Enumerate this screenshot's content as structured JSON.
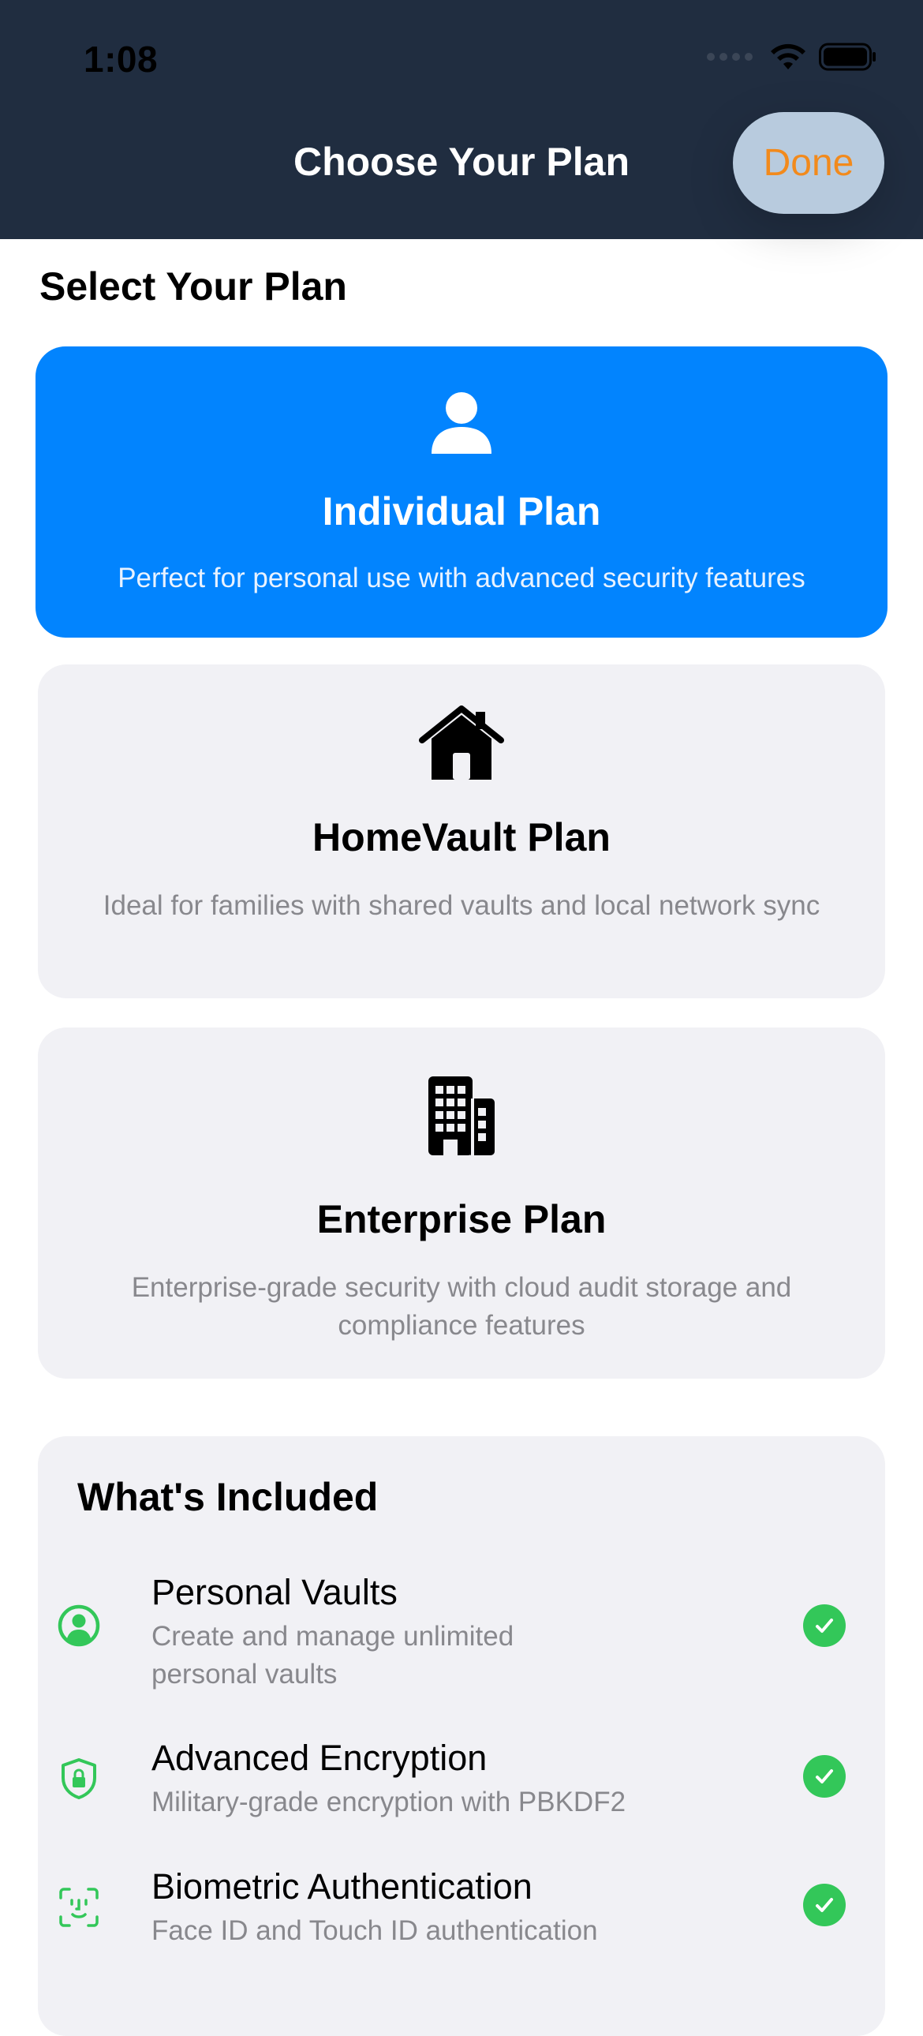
{
  "status_bar": {
    "time": "1:08",
    "icons": [
      "cellular-dots-icon",
      "wifi-icon",
      "battery-icon"
    ]
  },
  "nav": {
    "title": "Choose Your Plan",
    "done_label": "Done"
  },
  "plans_section": {
    "title": "Select Your Plan",
    "plans": [
      {
        "name": "Individual Plan",
        "description": "Perfect for personal use with advanced security features",
        "icon": "person-icon",
        "selected": true
      },
      {
        "name": "HomeVault Plan",
        "description": "Ideal for families with shared vaults and local network sync",
        "icon": "house-icon",
        "selected": false
      },
      {
        "name": "Enterprise Plan",
        "description": "Enterprise-grade security with cloud audit storage and compliance features",
        "icon": "building-icon",
        "selected": false
      }
    ]
  },
  "included": {
    "title": "What's Included",
    "features": [
      {
        "name": "Personal Vaults",
        "description": "Create and manage unlimited personal vaults",
        "icon": "person-circle-icon"
      },
      {
        "name": "Advanced Encryption",
        "description": "Military-grade encryption with PBKDF2",
        "icon": "lock-shield-icon"
      },
      {
        "name": "Biometric Authentication",
        "description": "Face ID and Touch ID authentication",
        "icon": "face-id-icon"
      }
    ]
  },
  "colors": {
    "header_bg": "#202d40",
    "selected_card": "#0284fe",
    "card_bg": "#f1f1f5",
    "done_text": "#f28a1c",
    "check_green": "#33c759"
  }
}
